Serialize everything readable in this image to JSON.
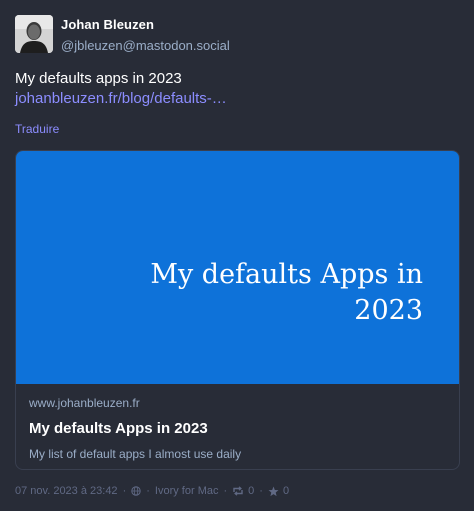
{
  "account": {
    "display_name": "Johan Bleuzen",
    "handle": "@jbleuzen@mastodon.social"
  },
  "content": {
    "text": "My defaults apps in 2023",
    "link_text": "johanbleuzen.fr/blog/defaults-…"
  },
  "translate_label": "Traduire",
  "card": {
    "image_title": "My defaults Apps in 2023",
    "provider": "www.johanbleuzen.fr",
    "title": "My defaults Apps in 2023",
    "description": "My list of default apps I almost use daily",
    "image_color": "#0e72d9"
  },
  "meta": {
    "timestamp": "07 nov. 2023 à 23:42",
    "separator": "·",
    "application": "Ivory for Mac",
    "visibility_icon": "globe-icon",
    "reblogs_count": "0",
    "favourites_count": "0"
  },
  "colors": {
    "background": "#282c37",
    "link": "#8c8dff",
    "secondary_text": "#9baec8",
    "meta_text": "#606984"
  }
}
